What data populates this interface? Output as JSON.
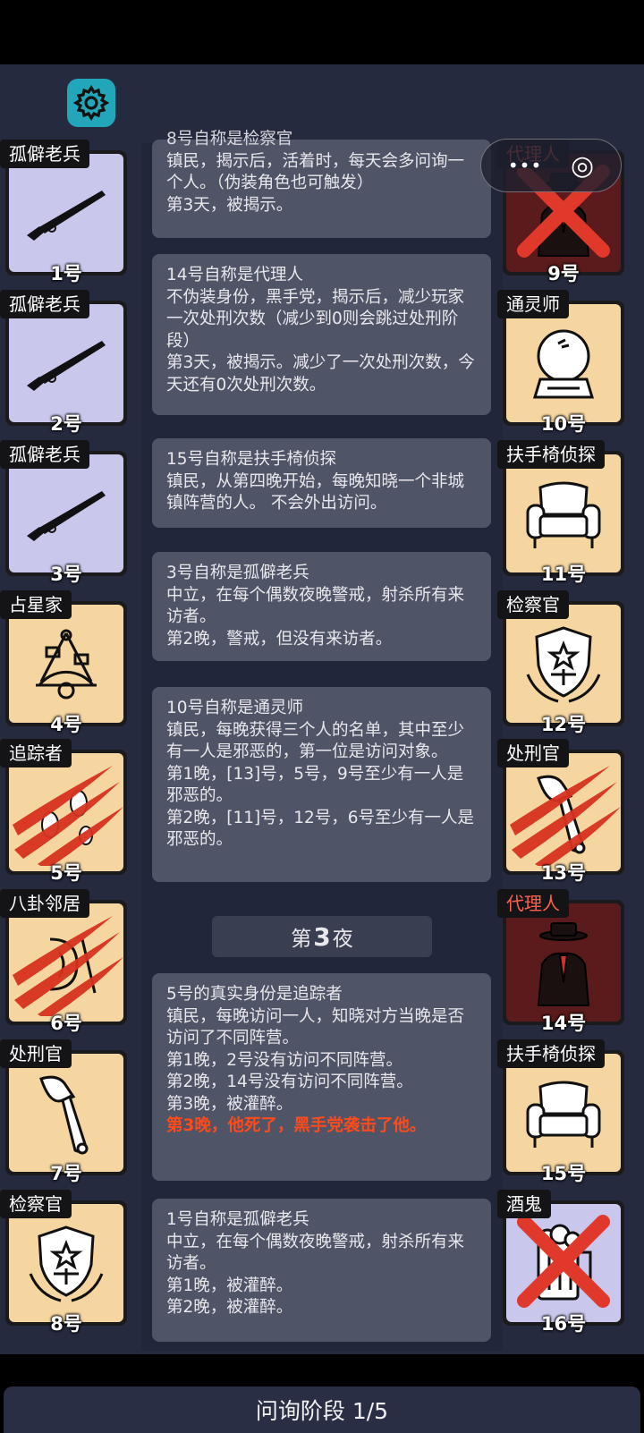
{
  "capsule": {
    "more": "•••",
    "target": "◎"
  },
  "log_cards": [
    {
      "top": "",
      "lines": [
        "8号自称是检察官",
        "镇民，揭示后，活着时，每天会多问询一个人。（伪装角色也可触发）",
        "第3天，被揭示。"
      ]
    },
    {
      "lines": [
        "14号自称是代理人",
        "不伪装身份，黑手党，揭示后，减少玩家一次处刑次数（减少到0则会跳过处刑阶段）",
        "第3天，被揭示。减少了一次处刑次数，今天还有0次处刑次数。"
      ]
    },
    {
      "lines": [
        "15号自称是扶手椅侦探",
        "镇民，从第四晚开始，每晚知晓一个非城镇阵营的人。 不会外出访问。"
      ]
    },
    {
      "lines": [
        "3号自称是孤僻老兵",
        "中立，在每个偶数夜晚警戒，射杀所有来访者。",
        "第2晚，警戒，但没有来访者。"
      ]
    },
    {
      "lines": [
        "10号自称是通灵师",
        "镇民，每晚获得三个人的名单，其中至少有一人是邪恶的，第一位是访问对象。",
        "第1晚，[13]号，5号，9号至少有一人是邪恶的。",
        "第2晚，[11]号，12号，6号至少有一人是邪恶的。"
      ]
    },
    {
      "lines": [
        "5号的真实身份是追踪者",
        "镇民，每晚访问一人，知晓对方当晚是否访问了不同阵营。",
        "第1晚，2号没有访问不同阵营。",
        "第2晚，14号没有访问不同阵营。",
        "第3晚，被灌醉。"
      ],
      "red": "第3晚，他死了，黑手党袭击了他。"
    },
    {
      "lines": [
        "1号自称是孤僻老兵",
        "中立，在每个偶数夜晚警戒，射杀所有来访者。",
        "第1晚，被灌醉。",
        "第2晚，被灌醉。"
      ]
    }
  ],
  "night_label": {
    "pre": "第",
    "num": "3",
    "post": "夜"
  },
  "left_players": [
    {
      "role": "孤僻老兵",
      "num": "1号",
      "icon": "rifle-icon",
      "bg": "lav"
    },
    {
      "role": "孤僻老兵",
      "num": "2号",
      "icon": "rifle-icon",
      "bg": "lav"
    },
    {
      "role": "孤僻老兵",
      "num": "3号",
      "icon": "rifle-icon",
      "bg": "lav"
    },
    {
      "role": "占星家",
      "num": "4号",
      "icon": "sextant-icon",
      "bg": "tan"
    },
    {
      "role": "追踪者",
      "num": "5号",
      "icon": "footprints-icon",
      "bg": "tan",
      "dead": "slash"
    },
    {
      "role": "八卦邻居",
      "num": "6号",
      "icon": "gossip-icon",
      "bg": "tan",
      "dead": "slash"
    },
    {
      "role": "处刑官",
      "num": "7号",
      "icon": "axe-icon",
      "bg": "tan"
    },
    {
      "role": "检察官",
      "num": "8号",
      "icon": "badge-icon",
      "bg": "tan"
    }
  ],
  "right_players": [
    {
      "role": "代理人",
      "num": "9号",
      "icon": "agent-icon",
      "bg": "dred",
      "evil": true,
      "dead": "cross"
    },
    {
      "role": "通灵师",
      "num": "10号",
      "icon": "crystal-ball-icon",
      "bg": "tan"
    },
    {
      "role": "扶手椅侦探",
      "num": "11号",
      "icon": "armchair-icon",
      "bg": "tan"
    },
    {
      "role": "检察官",
      "num": "12号",
      "icon": "badge-icon",
      "bg": "tan"
    },
    {
      "role": "处刑官",
      "num": "13号",
      "icon": "axe-icon",
      "bg": "tan",
      "dead": "slash"
    },
    {
      "role": "代理人",
      "num": "14号",
      "icon": "agent-icon",
      "bg": "dred",
      "evil": true
    },
    {
      "role": "扶手椅侦探",
      "num": "15号",
      "icon": "armchair-icon",
      "bg": "tan"
    },
    {
      "role": "酒鬼",
      "num": "16号",
      "icon": "beer-icon",
      "bg": "lav",
      "dead": "cross"
    }
  ],
  "phase": "问询阶段 1/5",
  "colors": {
    "accent": "#21a7b9",
    "death_red": "#e0392b",
    "evil_text": "#ff6050"
  }
}
